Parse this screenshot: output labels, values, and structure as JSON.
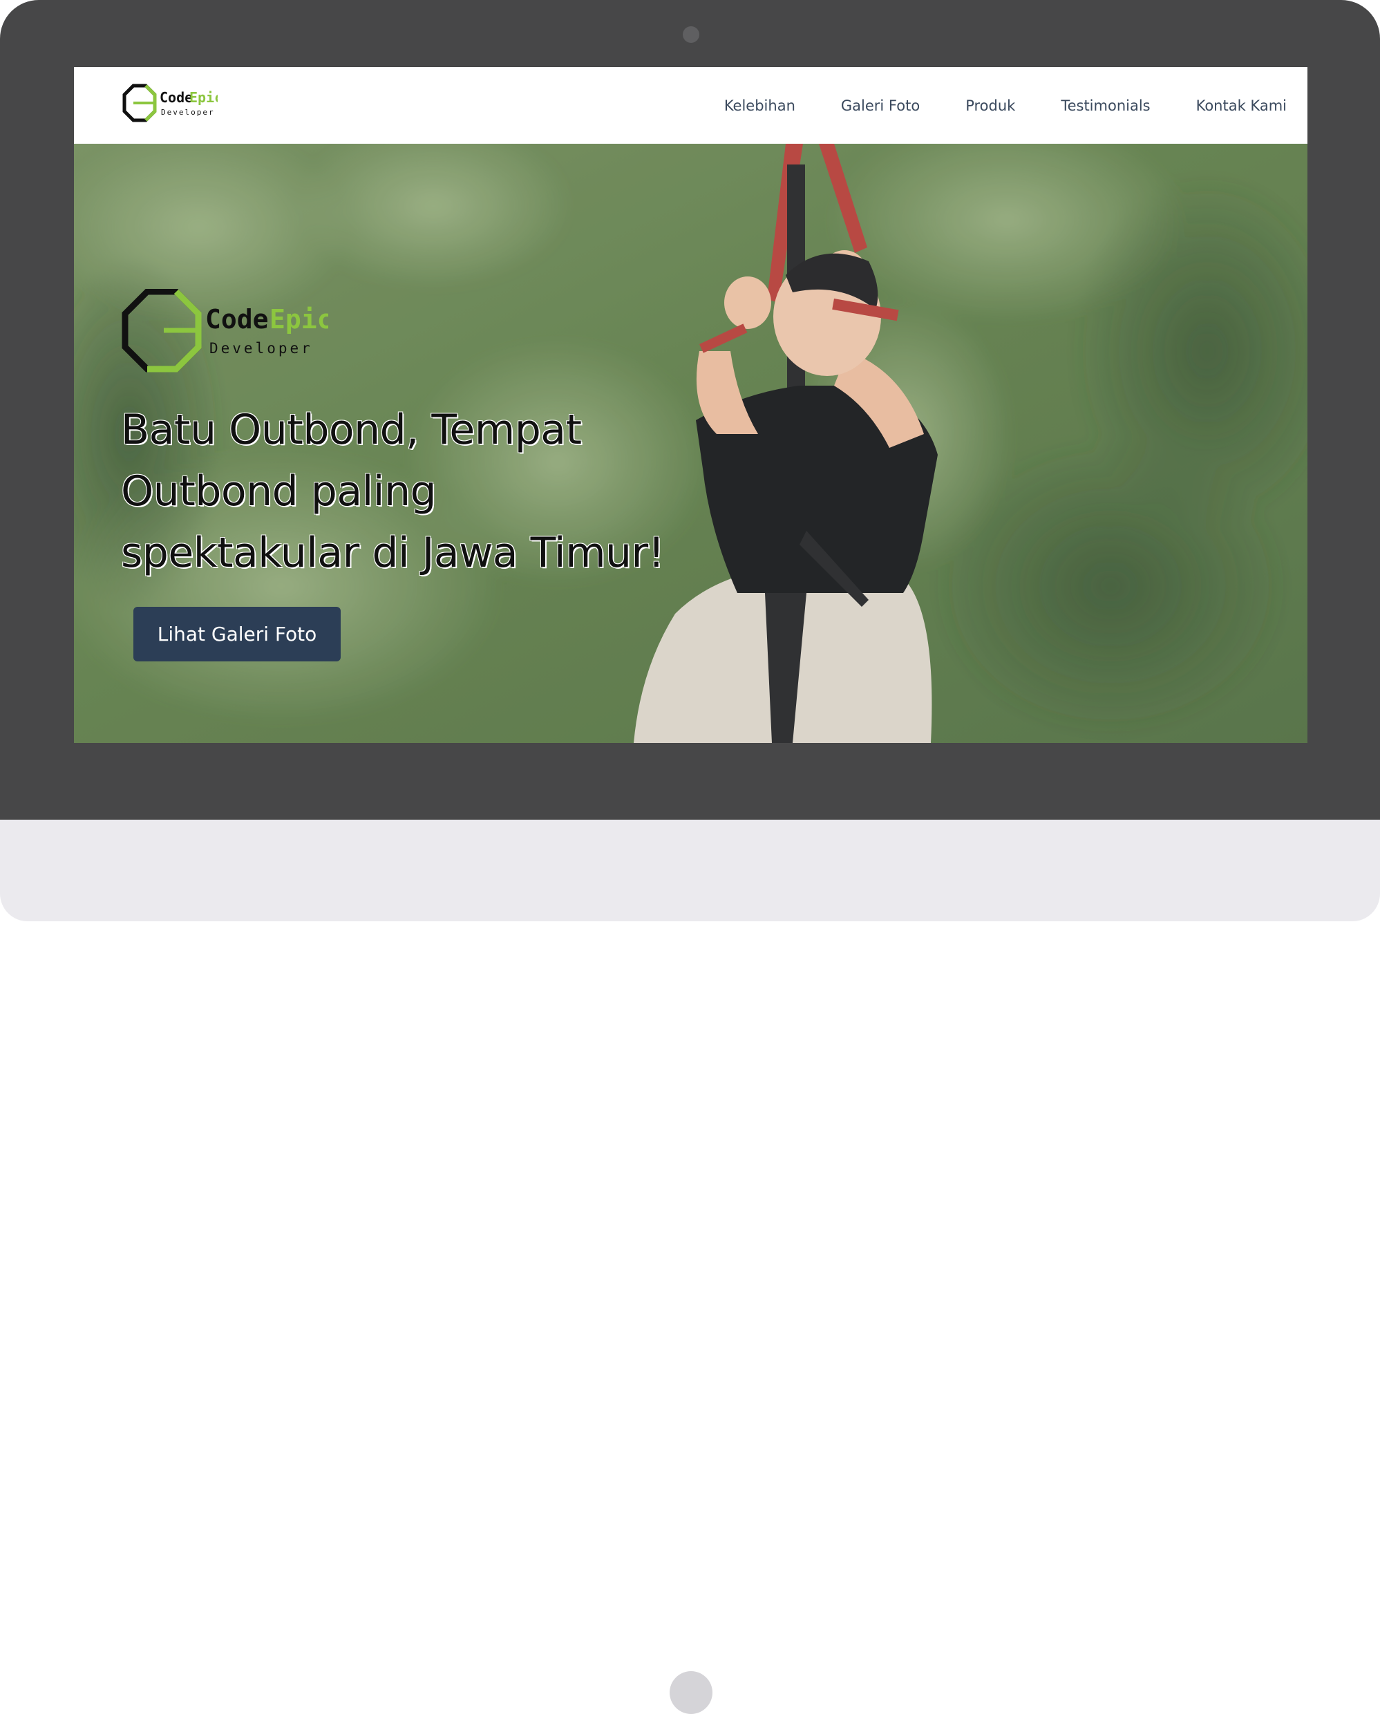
{
  "brand": {
    "name_part1": "Code",
    "name_part2": "Epic",
    "tagline": "Developer",
    "accent_color": "#8cc63f",
    "dark_color": "#111111"
  },
  "navbar": {
    "items": [
      {
        "label": "Kelebihan"
      },
      {
        "label": "Galeri Foto"
      },
      {
        "label": "Produk"
      },
      {
        "label": "Testimonials"
      },
      {
        "label": "Kontak Kami"
      }
    ],
    "text_color": "#3b4a5e"
  },
  "hero": {
    "heading_line1": "Batu Outbond, Tempat",
    "heading_line2": "Outbond paling",
    "heading_line3": "spektakular di Jawa Timur!",
    "cta_label": "Lihat Galeri Foto",
    "cta_color": "#2c3e56",
    "background": "photo of a man riding a flying fox zipline in a forest"
  },
  "device": {
    "bezel_color": "#474748",
    "chin_color": "#ebeaee"
  }
}
